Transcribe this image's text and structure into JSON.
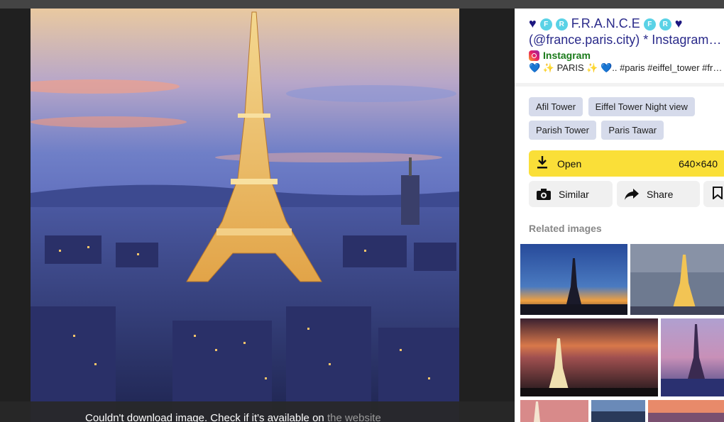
{
  "panel": {
    "title_line1": "F.R.A.N.C.E",
    "title_line2": "(@france.paris.city) * Instagram photos and videos",
    "badge_f": "F",
    "badge_r": "R",
    "heart": "♥",
    "source": "Instagram",
    "description": "💙 ✨ PARIS ✨ 💙.. #paris #eiffel_tower #france #night",
    "tags": [
      "Afil Tower",
      "Eiffel Tower Night view",
      "Parish Tower",
      "Paris Tawar"
    ],
    "open_label": "Open",
    "image_size": "640×640",
    "similar_label": "Similar",
    "share_label": "Share",
    "related_label": "Related images"
  },
  "toast": {
    "message": "Couldn't download image. Check if it's available on",
    "link_text": "the website"
  },
  "colors": {
    "accent_yellow": "#fadf38",
    "tag_bg": "#d6dbeb",
    "title_color": "#2a2a8a",
    "source_color": "#1a7a1a"
  }
}
